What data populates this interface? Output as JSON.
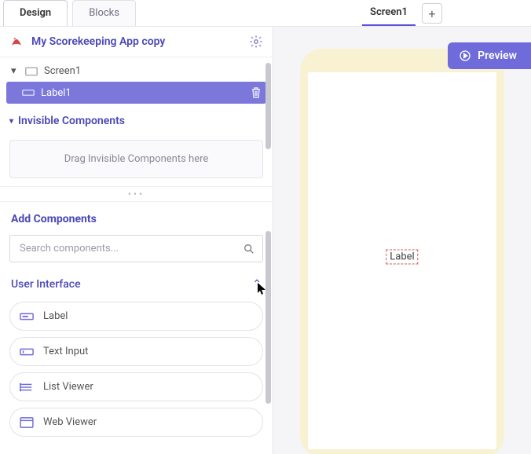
{
  "tabs": {
    "design": "Design",
    "blocks": "Blocks"
  },
  "screens": {
    "current": "Screen1"
  },
  "project": {
    "title": "My Scorekeeping App copy"
  },
  "tree": {
    "screen": "Screen1",
    "selected_component": "Label1"
  },
  "invisible": {
    "title": "Invisible Components",
    "dropzone": "Drag Invisible Components here"
  },
  "add_components": {
    "title": "Add Components",
    "search_placeholder": "Search components...",
    "category": "User Interface",
    "items": [
      "Label",
      "Text Input",
      "List Viewer",
      "Web Viewer"
    ]
  },
  "preview": {
    "button": "Preview",
    "placed_label": "Label"
  },
  "colors": {
    "accent": "#6f6bda",
    "accent_dark": "#4a47b5",
    "selection": "#7b77db"
  }
}
